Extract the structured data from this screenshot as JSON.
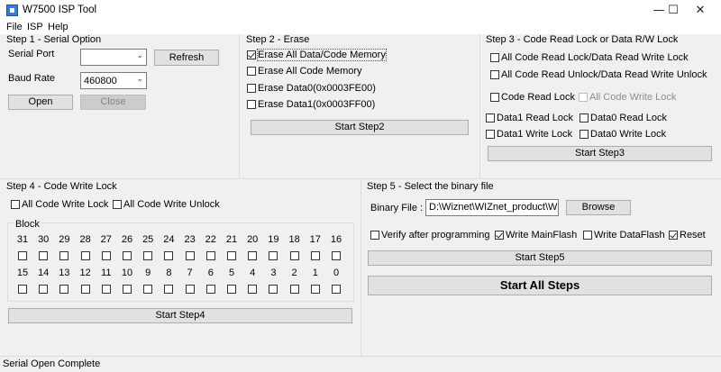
{
  "window": {
    "title": "W7500 ISP Tool",
    "minimize": "—",
    "maximize": "☐",
    "close": "✕"
  },
  "menu": [
    "File",
    "ISP",
    "Help"
  ],
  "step1": {
    "title": "Step 1 - Serial Option",
    "serial_port_label": "Serial Port",
    "serial_port_value": "",
    "refresh": "Refresh",
    "baud_rate_label": "Baud Rate",
    "baud_rate_value": "460800",
    "open": "Open",
    "close": "Close"
  },
  "step2": {
    "title": "Step 2 - Erase",
    "options": [
      {
        "label": "Erase All Data/Code Memory",
        "checked": true
      },
      {
        "label": "Erase All Code Memory",
        "checked": false
      },
      {
        "label": "Erase Data0(0x0003FE00)",
        "checked": false
      },
      {
        "label": "Erase Data1(0x0003FF00)",
        "checked": false
      }
    ],
    "start": "Start Step2"
  },
  "step3": {
    "title": "Step 3 - Code Read Lock or Data R/W Lock",
    "all_lock": "All Code Read Lock/Data Read Write Lock",
    "all_unlock": "All Code Read Unlock/Data Read Write Unlock",
    "code_read_lock": "Code Read Lock",
    "all_code_write_lock": "All Code Write Lock",
    "data1_read_lock": "Data1 Read Lock",
    "data0_read_lock": "Data0 Read Lock",
    "data1_write_lock": "Data1 Write Lock",
    "data0_write_lock": "Data0 Write Lock",
    "start": "Start Step3"
  },
  "step4": {
    "title": "Step 4 - Code Write Lock",
    "all_lock": "All Code Write Lock",
    "all_unlock": "All Code Write Unlock",
    "block_label": "Block",
    "row1": [
      "31",
      "30",
      "29",
      "28",
      "27",
      "26",
      "25",
      "24",
      "23",
      "22",
      "21",
      "20",
      "19",
      "18",
      "17",
      "16"
    ],
    "row2": [
      "15",
      "14",
      "13",
      "12",
      "11",
      "10",
      "9",
      "8",
      "7",
      "6",
      "5",
      "4",
      "3",
      "2",
      "1",
      "0"
    ],
    "start": "Start Step4"
  },
  "step5": {
    "title": "Step 5 - Select the binary file",
    "binary_label": "Binary File :",
    "binary_value": "D:\\Wiznet\\WIZnet_product\\W",
    "browse": "Browse",
    "verify": "Verify after programming",
    "write_main": "Write MainFlash",
    "write_data": "Write DataFlash",
    "reset": "Reset",
    "verify_checked": false,
    "write_main_checked": true,
    "write_data_checked": false,
    "reset_checked": true,
    "start": "Start Step5",
    "start_all": "Start All Steps"
  },
  "status": "Serial Open Complete"
}
